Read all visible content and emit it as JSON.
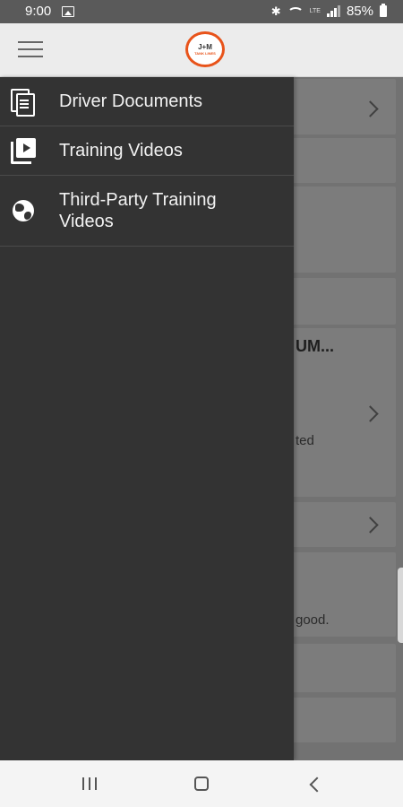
{
  "status_bar": {
    "time": "9:00",
    "lte": "LTE",
    "battery": "85%"
  },
  "header": {
    "logo_main": "J+M",
    "logo_sub": "TANK LINES"
  },
  "drawer": {
    "items": [
      {
        "label": "Driver Documents",
        "icon": "document-icon"
      },
      {
        "label": "Training Videos",
        "icon": "video-library-icon"
      },
      {
        "label": "Third-Party Training Videos",
        "icon": "globe-icon"
      }
    ]
  },
  "background": {
    "partial_title": "UM...",
    "partial_text_1": "ted",
    "partial_text_2": "good."
  },
  "colors": {
    "drawer_bg": "#333333",
    "header_bg": "#ececec",
    "logo_accent": "#e8531a"
  }
}
